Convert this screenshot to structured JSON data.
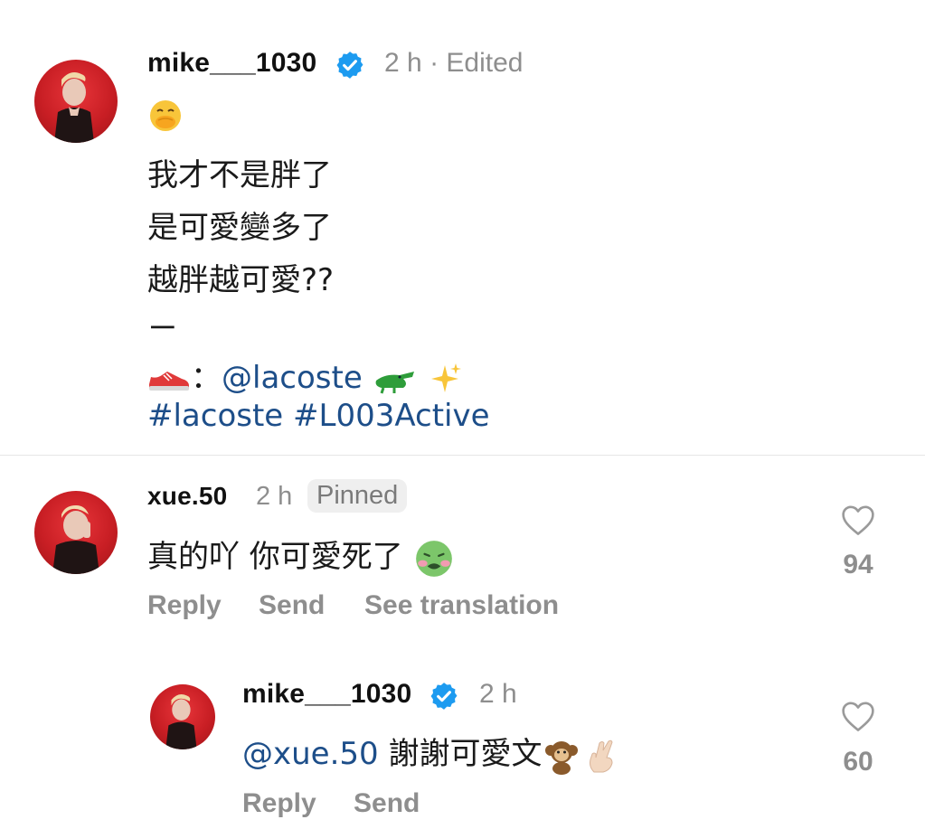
{
  "post": {
    "username": "mike___1030",
    "time": "2 h",
    "separator": "·",
    "edited": "Edited",
    "caption_lines": [
      "我才不是胖了",
      "是可愛變多了",
      "越胖越可愛??",
      "ㄧ"
    ],
    "shoe_sep": "：",
    "mention": "@lacoste",
    "hashtags": "#lacoste #L003Active",
    "icons": [
      "face-hand-over-mouth-icon",
      "sneaker-icon",
      "crocodile-icon",
      "sparkles-icon"
    ]
  },
  "comments": [
    {
      "username": "xue.50",
      "time": "2 h",
      "badge": "Pinned",
      "text": "真的吖 你可愛死了",
      "emoji": "nauseated-face-icon",
      "likes": "94",
      "actions": {
        "reply": "Reply",
        "send": "Send",
        "translate": "See translation"
      }
    }
  ],
  "reply": {
    "username": "mike___1030",
    "time": "2 h",
    "mention": "@xue.50",
    "text": "謝謝可愛文",
    "emojis": [
      "monkey-icon",
      "crossed-fingers-icon"
    ],
    "likes": "60",
    "actions": {
      "reply": "Reply",
      "send": "Send"
    }
  },
  "colors": {
    "link": "#1d4e89",
    "verified": "#1d9bf0",
    "muted": "#8e8e8e",
    "avatar_bg": "#d8262c"
  }
}
